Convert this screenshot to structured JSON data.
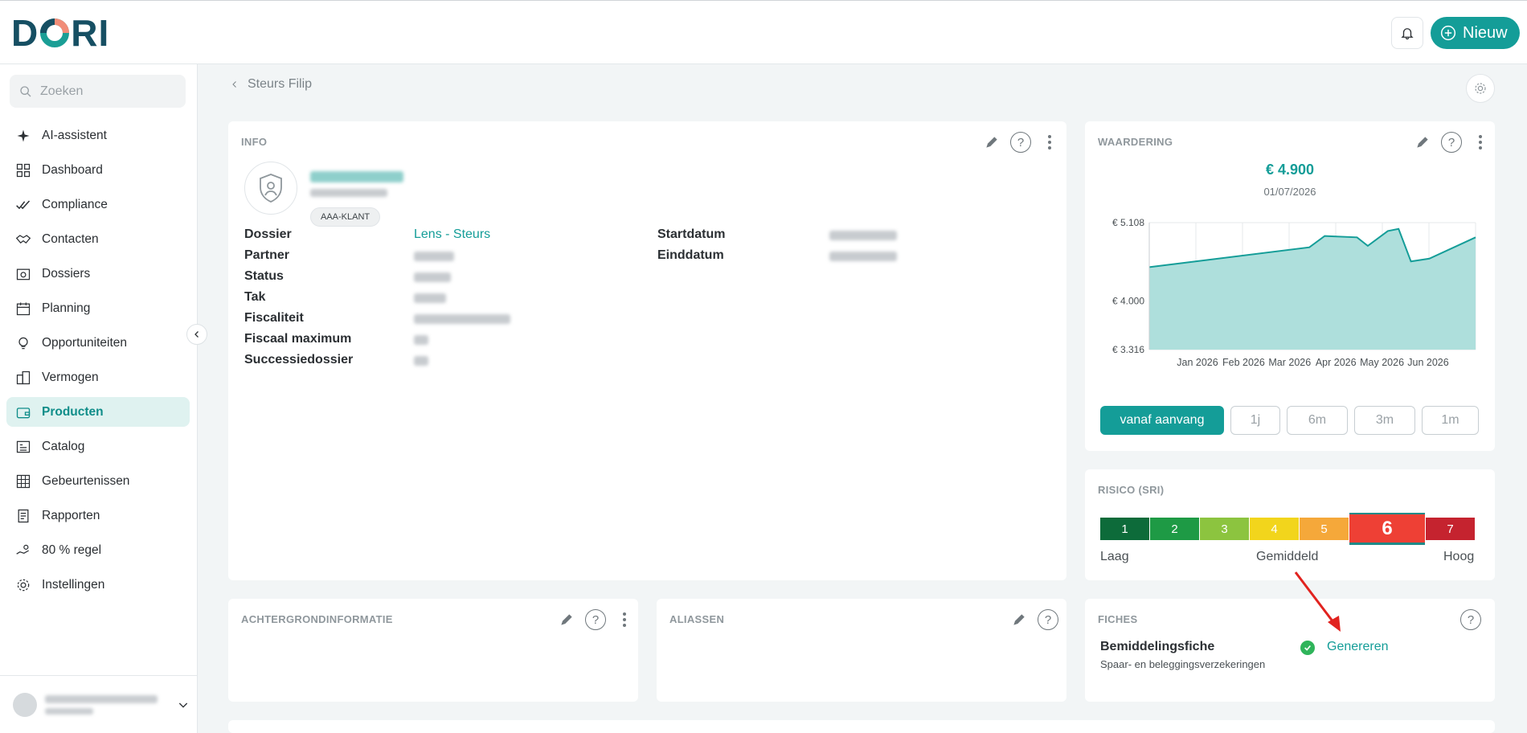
{
  "app": {
    "logo_text": "DORI",
    "new_button_label": "Nieuw",
    "accent_color": "#149d98"
  },
  "sidebar": {
    "search_placeholder": "Zoeken",
    "items": [
      {
        "label": "AI-assistent",
        "icon": "sparkle-icon",
        "active": false
      },
      {
        "label": "Dashboard",
        "icon": "dashboard-grid-icon",
        "active": false
      },
      {
        "label": "Compliance",
        "icon": "double-check-icon",
        "active": false
      },
      {
        "label": "Contacten",
        "icon": "handshake-icon",
        "active": false
      },
      {
        "label": "Dossiers",
        "icon": "money-box-icon",
        "active": false
      },
      {
        "label": "Planning",
        "icon": "calendar-icon",
        "active": false
      },
      {
        "label": "Opportuniteiten",
        "icon": "lightbulb-icon",
        "active": false
      },
      {
        "label": "Vermogen",
        "icon": "buildings-icon",
        "active": false
      },
      {
        "label": "Producten",
        "icon": "wallet-icon",
        "active": true
      },
      {
        "label": "Catalog",
        "icon": "catalog-icon",
        "active": false
      },
      {
        "label": "Gebeurtenissen",
        "icon": "table-icon",
        "active": false
      },
      {
        "label": "Rapporten",
        "icon": "report-icon",
        "active": false
      },
      {
        "label": "80 % regel",
        "icon": "hand-coins-icon",
        "active": false
      },
      {
        "label": "Instellingen",
        "icon": "gear-icon",
        "active": false
      }
    ],
    "user_name": "",
    "user_role": ""
  },
  "breadcrumb": {
    "back_label": "Steurs Filip"
  },
  "info": {
    "title": "INFO",
    "product_name": "",
    "product_number": "",
    "badge": "AAA-KLANT",
    "fields_left": [
      {
        "label": "Dossier",
        "value": "Lens - Steurs",
        "link": true
      },
      {
        "label": "Partner",
        "value": "",
        "link": false
      },
      {
        "label": "Status",
        "value": "",
        "link": false
      },
      {
        "label": "Tak",
        "value": "",
        "link": false
      },
      {
        "label": "Fiscaliteit",
        "value": "",
        "link": false
      },
      {
        "label": "Fiscaal maximum",
        "value": "",
        "link": false
      },
      {
        "label": "Successiedossier",
        "value": "",
        "link": false
      }
    ],
    "fields_right": [
      {
        "label": "Startdatum",
        "value": ""
      },
      {
        "label": "Einddatum",
        "value": ""
      }
    ]
  },
  "waardering": {
    "title": "WAARDERING",
    "amount": "€ 4.900",
    "date": "01/07/2026",
    "ranges": [
      "vanaf aanvang",
      "1j",
      "6m",
      "3m",
      "1m"
    ],
    "active_range": "vanaf aanvang"
  },
  "chart_data": {
    "type": "area",
    "title": "",
    "xlabel": "",
    "ylabel": "",
    "ylim": [
      3316,
      5108
    ],
    "yticks": [
      3316,
      4000,
      5108
    ],
    "ytick_labels": [
      "€ 3.316",
      "€ 4.000",
      "€ 5.108"
    ],
    "xticks": [
      "Jan 2026",
      "Feb 2026",
      "Mar 2026",
      "Apr 2026",
      "May 2026",
      "Jun 2026"
    ],
    "x": [
      "2025-12-01",
      "2026-03-15",
      "2026-03-25",
      "2026-04-15",
      "2026-04-22",
      "2026-05-05",
      "2026-05-12",
      "2026-05-20",
      "2026-06-01",
      "2026-07-01"
    ],
    "series": [
      {
        "values": [
          4480,
          4760,
          4920,
          4900,
          4780,
          4990,
          5020,
          4560,
          4600,
          4900
        ],
        "color": "#149d98",
        "fill": "#aedfdc"
      }
    ],
    "grid": true
  },
  "risico": {
    "title": "RISICO (SRI)",
    "levels": [
      "1",
      "2",
      "3",
      "4",
      "5",
      "6",
      "7"
    ],
    "colors": [
      "#0d6b3a",
      "#1e9a45",
      "#8cc43f",
      "#f2d51c",
      "#f5a83a",
      "#ee4035",
      "#c5232f"
    ],
    "selected": "6",
    "label_low": "Laag",
    "label_mid": "Gemiddeld",
    "label_high": "Hoog"
  },
  "achtergrond": {
    "title": "ACHTERGRONDINFORMATIE"
  },
  "aliassen": {
    "title": "ALIASSEN"
  },
  "fiches": {
    "title": "FICHES",
    "item_title": "Bemiddelingsfiche",
    "item_subtitle": "Spaar- en beleggingsverzekeringen",
    "action_label": "Genereren"
  }
}
